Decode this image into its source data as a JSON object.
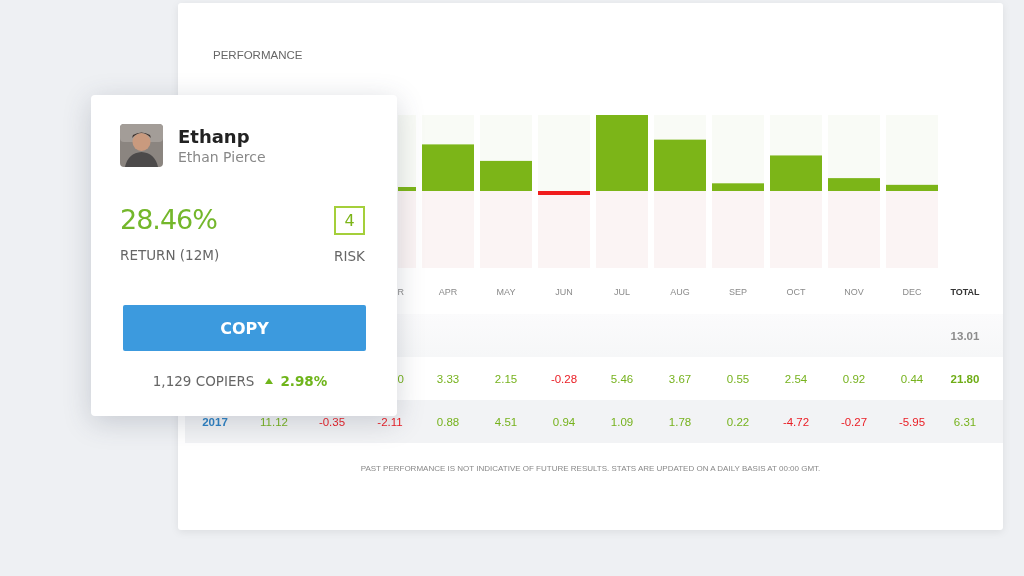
{
  "performance": {
    "title": "PERFORMANCE",
    "columns": [
      null,
      null,
      null,
      {
        "label": "R",
        "kind": "month",
        "cut": true
      },
      {
        "label": "APR",
        "kind": "month"
      },
      {
        "label": "MAY",
        "kind": "month"
      },
      {
        "label": "JUN",
        "kind": "month"
      },
      {
        "label": "JUL",
        "kind": "month"
      },
      {
        "label": "AUG",
        "kind": "month"
      },
      {
        "label": "SEP",
        "kind": "month"
      },
      {
        "label": "OCT",
        "kind": "month"
      },
      {
        "label": "NOV",
        "kind": "month"
      },
      {
        "label": "DEC",
        "kind": "month"
      },
      {
        "label": "TOTAL",
        "kind": "total"
      }
    ],
    "rows": [
      {
        "cells": [
          null,
          null,
          null,
          null,
          null,
          null,
          null,
          null,
          null,
          null,
          null,
          null,
          null,
          {
            "text": "13.01",
            "kind": "muted"
          }
        ]
      },
      {
        "cells": [
          null,
          null,
          null,
          {
            "text": "0",
            "kind": "pos",
            "cut": true
          },
          {
            "text": "3.33",
            "kind": "pos"
          },
          {
            "text": "2.15",
            "kind": "pos"
          },
          {
            "text": "-0.28",
            "kind": "neg"
          },
          {
            "text": "5.46",
            "kind": "pos"
          },
          {
            "text": "3.67",
            "kind": "pos"
          },
          {
            "text": "0.55",
            "kind": "pos"
          },
          {
            "text": "2.54",
            "kind": "pos"
          },
          {
            "text": "0.92",
            "kind": "pos"
          },
          {
            "text": "0.44",
            "kind": "pos"
          },
          {
            "text": "21.80",
            "kind": "total"
          }
        ]
      },
      {
        "cells": [
          {
            "text": "2017",
            "kind": "year"
          },
          {
            "text": "11.12",
            "kind": "pos"
          },
          {
            "text": "-0.35",
            "kind": "neg"
          },
          {
            "text": "-2.11",
            "kind": "neg"
          },
          {
            "text": "0.88",
            "kind": "pos"
          },
          {
            "text": "4.51",
            "kind": "pos"
          },
          {
            "text": "0.94",
            "kind": "pos"
          },
          {
            "text": "1.09",
            "kind": "pos"
          },
          {
            "text": "1.78",
            "kind": "pos"
          },
          {
            "text": "0.22",
            "kind": "pos"
          },
          {
            "text": "-4.72",
            "kind": "neg"
          },
          {
            "text": "-0.27",
            "kind": "neg"
          },
          {
            "text": "-5.95",
            "kind": "neg"
          },
          {
            "text": "6.31",
            "kind": "pos"
          }
        ]
      }
    ],
    "disclaimer": "PAST PERFORMANCE IS NOT INDICATIVE OF FUTURE RESULTS. STATS ARE UPDATED ON A DAILY BASIS AT 00:00 GMT."
  },
  "card": {
    "username": "Ethanp",
    "full_name": "Ethan Pierce",
    "return_value": "28.46%",
    "return_label": "RETURN (12M)",
    "risk": "4",
    "risk_label": "RISK",
    "button": "COPY",
    "copiers": "1,129 COPIERS",
    "change": "2.98%"
  }
}
